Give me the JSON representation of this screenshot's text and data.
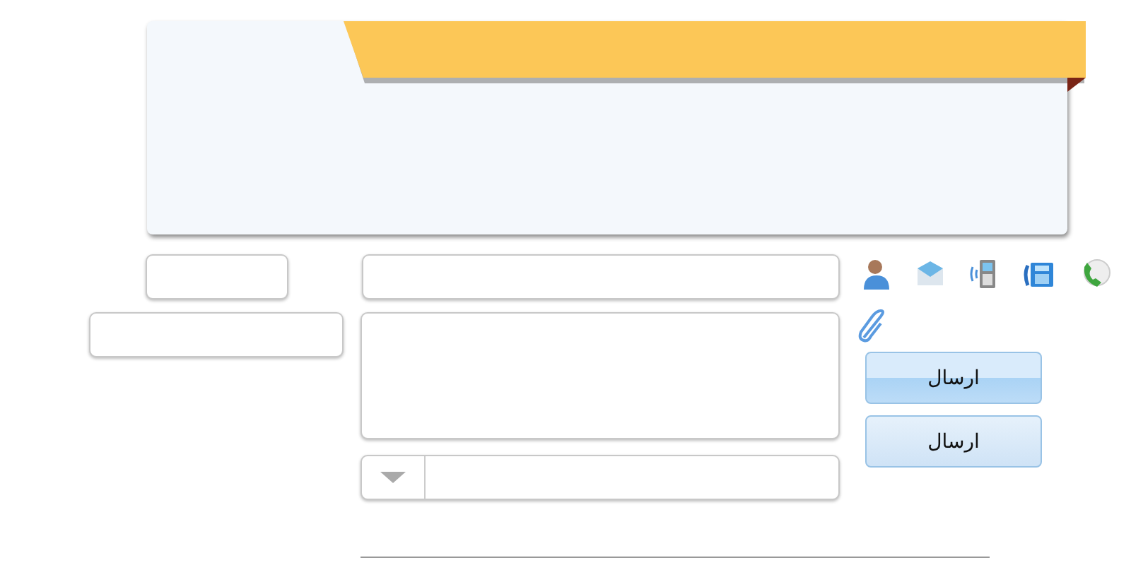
{
  "buttons": [
    {
      "label": "ارسال",
      "selected": true
    },
    {
      "label": "ارسال",
      "selected": false
    }
  ]
}
